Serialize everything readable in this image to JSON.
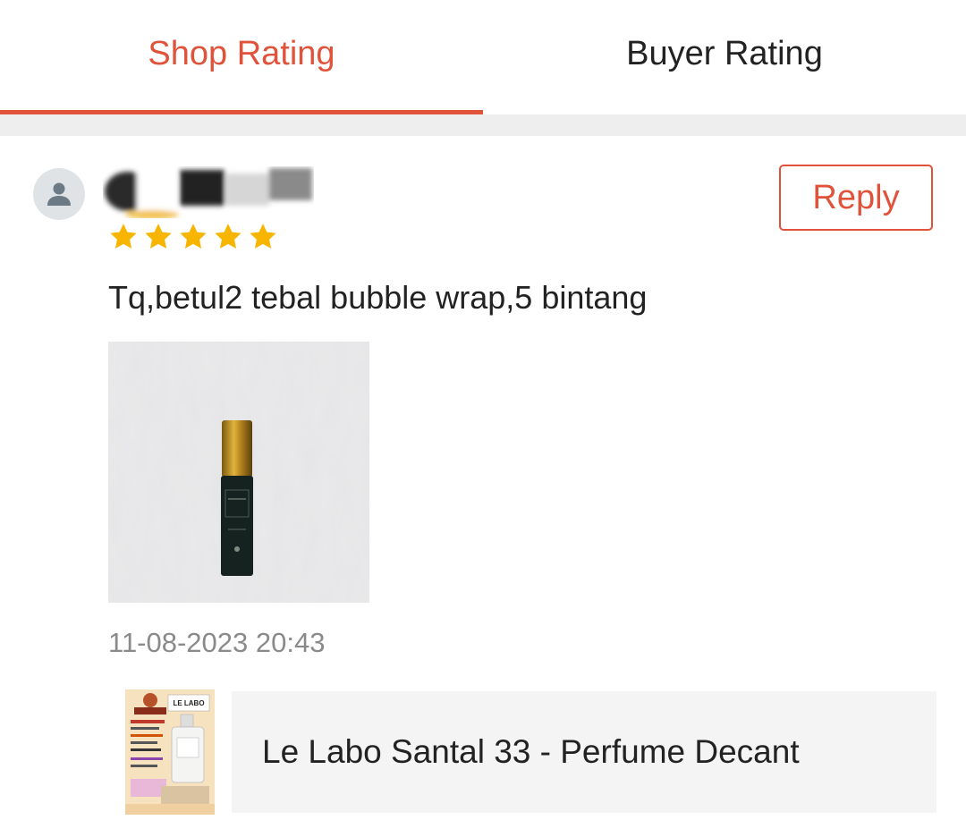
{
  "tabs": {
    "shop_rating": "Shop Rating",
    "buyer_rating": "Buyer Rating",
    "active": "shop_rating"
  },
  "review": {
    "rating": 5,
    "reply_label": "Reply",
    "comment": "Tq,betul2 tebal bubble wrap,5 bintang",
    "timestamp": "11-08-2023 20:43",
    "product": {
      "name": "Le Labo Santal 33 - Perfume Decant",
      "thumbnail_brand": "LE LABO"
    }
  },
  "colors": {
    "accent": "#e0533a",
    "star": "#f7b500",
    "divider": "#eeeeee",
    "product_bg": "#f4f4f4"
  },
  "icons": {
    "avatar": "person-icon",
    "rating": "star-icon"
  }
}
